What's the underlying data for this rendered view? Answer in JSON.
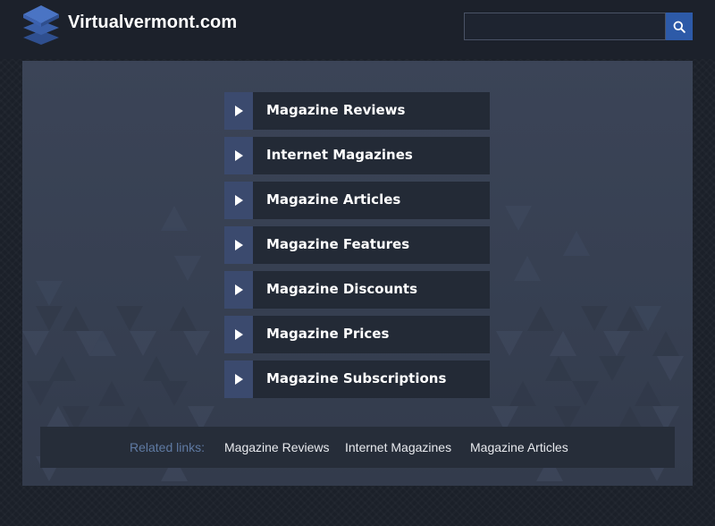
{
  "header": {
    "site_title": "Virtualvermont.com",
    "logo_icon": "stacked-layers-icon",
    "search": {
      "placeholder": "",
      "value": "",
      "button_icon": "search-icon"
    }
  },
  "menu": {
    "arrow_icon": "play-arrow-icon",
    "items": [
      {
        "label": "Magazine Reviews"
      },
      {
        "label": "Internet Magazines"
      },
      {
        "label": "Magazine Articles"
      },
      {
        "label": "Magazine Features"
      },
      {
        "label": "Magazine Discounts"
      },
      {
        "label": "Magazine Prices"
      },
      {
        "label": "Magazine Subscriptions"
      }
    ]
  },
  "related": {
    "title": "Related links:",
    "links": [
      {
        "label": "Magazine Reviews"
      },
      {
        "label": "Internet Magazines"
      },
      {
        "label": "Magazine Articles"
      }
    ]
  },
  "colors": {
    "page_bg": "#1b2029",
    "header_bg": "#1c212b",
    "panel_bg": "#3b4457",
    "menu_item_bg": "#232a36",
    "arrow_box": "#3b4a6e",
    "search_button": "#2d5aa8",
    "related_title": "#5f7aa3"
  }
}
